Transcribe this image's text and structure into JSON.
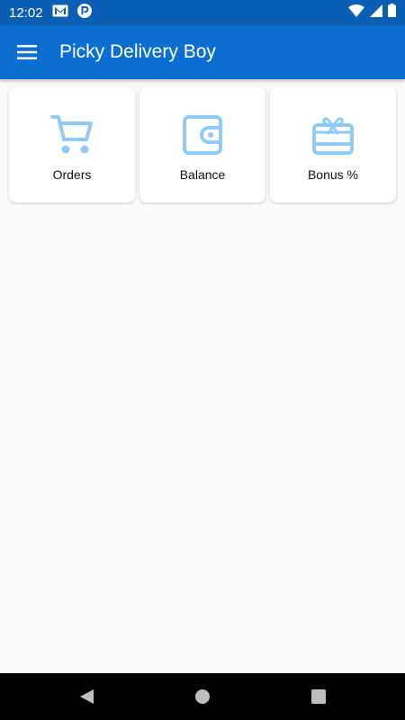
{
  "status_bar": {
    "time": "12:02",
    "icons": [
      "gmail-icon",
      "app-notification-icon",
      "wifi-icon",
      "signal-icon",
      "battery-icon"
    ]
  },
  "app_bar": {
    "title": "Picky Delivery Boy",
    "menu_icon": "hamburger-menu-icon"
  },
  "cards": [
    {
      "label": "Orders",
      "icon": "shopping-cart-icon"
    },
    {
      "label": "Balance",
      "icon": "wallet-icon"
    },
    {
      "label": "Bonus %",
      "icon": "gift-card-icon"
    }
  ],
  "nav_bar": {
    "icons": [
      "back-icon",
      "home-icon",
      "recents-icon"
    ]
  },
  "colors": {
    "status_bar": "#0a5fb4",
    "app_bar": "#0a6fd0",
    "card_icon": "#90caf9",
    "background": "#fafafa"
  }
}
